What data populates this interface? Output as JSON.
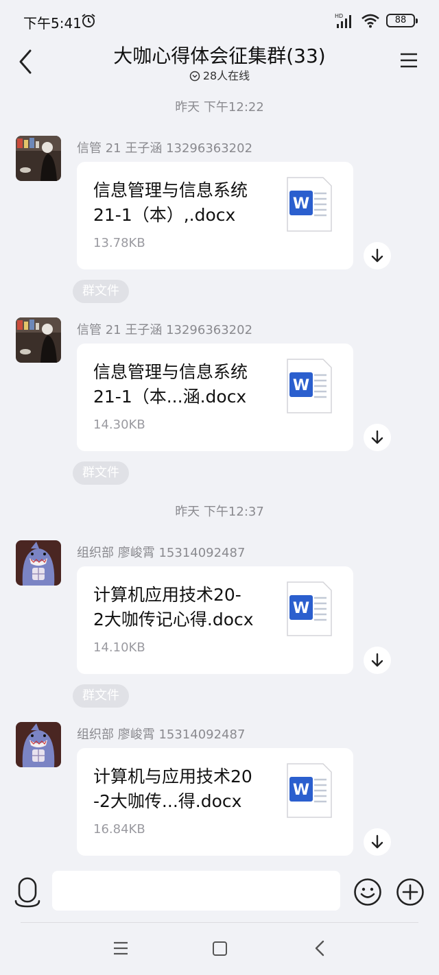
{
  "status_bar": {
    "time": "下午5:41",
    "battery": "88",
    "network": "HD"
  },
  "header": {
    "title": "大咖心得体会征集群(33)",
    "online": "28人在线"
  },
  "messages": [
    {
      "divider": "昨天 下午12:22",
      "sender": "信管 21 王子涵 13296363202",
      "file_line1": "信息管理与信息系统",
      "file_line2": "21-1（本）,.docx",
      "size": "13.78KB",
      "tag": "群文件",
      "avatar": "photo"
    },
    {
      "sender": "信管 21 王子涵 13296363202",
      "file_line1": "信息管理与信息系统",
      "file_line2": "21-1（本...涵.docx",
      "size": "14.30KB",
      "tag": "群文件",
      "avatar": "photo"
    },
    {
      "divider": "昨天 下午12:37",
      "sender": "组织部 廖峻霄 15314092487",
      "file_line1": "计算机应用技术20-",
      "file_line2": "2大咖传记心得.docx",
      "size": "14.10KB",
      "tag": "群文件",
      "avatar": "shark"
    },
    {
      "sender": "组织部 廖峻霄 15314092487",
      "file_line1": "计算机与应用技术20",
      "file_line2": "-2大咖传...得.docx",
      "size": "16.84KB",
      "avatar": "shark"
    }
  ],
  "input": {
    "placeholder": "",
    "value": ""
  },
  "colors": {
    "background": "#f1f2f6",
    "word_blue": "#2b5fce",
    "muted_text": "#8a8a8f"
  }
}
